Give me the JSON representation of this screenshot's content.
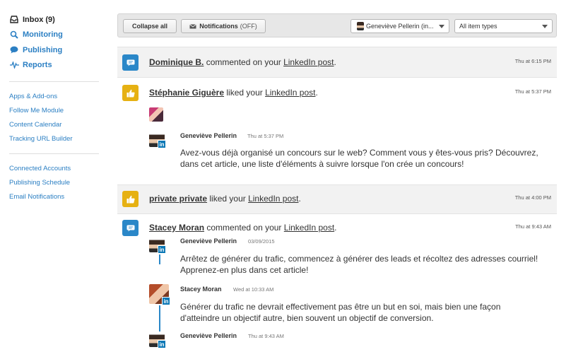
{
  "sidebar": {
    "main": [
      {
        "label": "Inbox (9)",
        "icon": "inbox-icon"
      },
      {
        "label": "Monitoring",
        "icon": "search-icon"
      },
      {
        "label": "Publishing",
        "icon": "speech-bubble-icon"
      },
      {
        "label": "Reports",
        "icon": "pulse-icon"
      }
    ],
    "group1": [
      "Apps & Add-ons",
      "Follow Me Module",
      "Content Calendar",
      "Tracking URL Builder"
    ],
    "group2": [
      "Connected Accounts",
      "Publishing Schedule",
      "Email Notifications"
    ]
  },
  "toolbar": {
    "collapse_label": "Collapse all",
    "notifications_label": "Notifications",
    "notifications_state": "(OFF)",
    "account_select": "Geneviève Pellerin (in...",
    "type_select": "All item types"
  },
  "feed": [
    {
      "actor": "Dominique B.",
      "action": "commented on your",
      "target": "LinkedIn post",
      "time": "Thu at 6:15 PM",
      "type": "comment"
    },
    {
      "actor": "Stéphanie Giguère",
      "action": "liked your",
      "target": "LinkedIn post",
      "time": "Thu at 5:37 PM",
      "type": "like",
      "comment": {
        "name": "Geneviève Pellerin",
        "time": "Thu at 5:37 PM",
        "text": "Avez-vous déjà organisé un concours sur le web? Comment vous y êtes-vous pris? Découvrez, dans cet article, une liste d'éléments à suivre lorsque l'on crée un concours!"
      }
    },
    {
      "actor": "private private",
      "action": "liked your",
      "target": "LinkedIn post",
      "time": "Thu at 4:00 PM",
      "type": "like"
    },
    {
      "actor": "Stacey Moran",
      "action": "commented on your",
      "target": "LinkedIn post",
      "time": "Thu at 9:43 AM",
      "type": "comment",
      "thread": [
        {
          "name": "Geneviève Pellerin",
          "time": "03/09/2015",
          "text": "Arrêtez de générer du trafic, commencez à générer des leads et récoltez des adresses courriel! Apprenez-en plus dans cet article!"
        },
        {
          "name": "Stacey Moran",
          "time": "Wed at 10:33 AM",
          "text": "Générer du trafic ne devrait effectivement pas être un but en soi, mais bien une façon d'atteindre un objectif autre, bien souvent un objectif de conversion."
        },
        {
          "name": "Geneviève Pellerin",
          "time": "Thu at 9:43 AM",
          "text": ""
        }
      ]
    }
  ],
  "colors": {
    "link": "#2b7fc3",
    "comment_badge": "#2a87c8",
    "like_badge": "#e6b113",
    "linkedin": "#0a77b5"
  }
}
